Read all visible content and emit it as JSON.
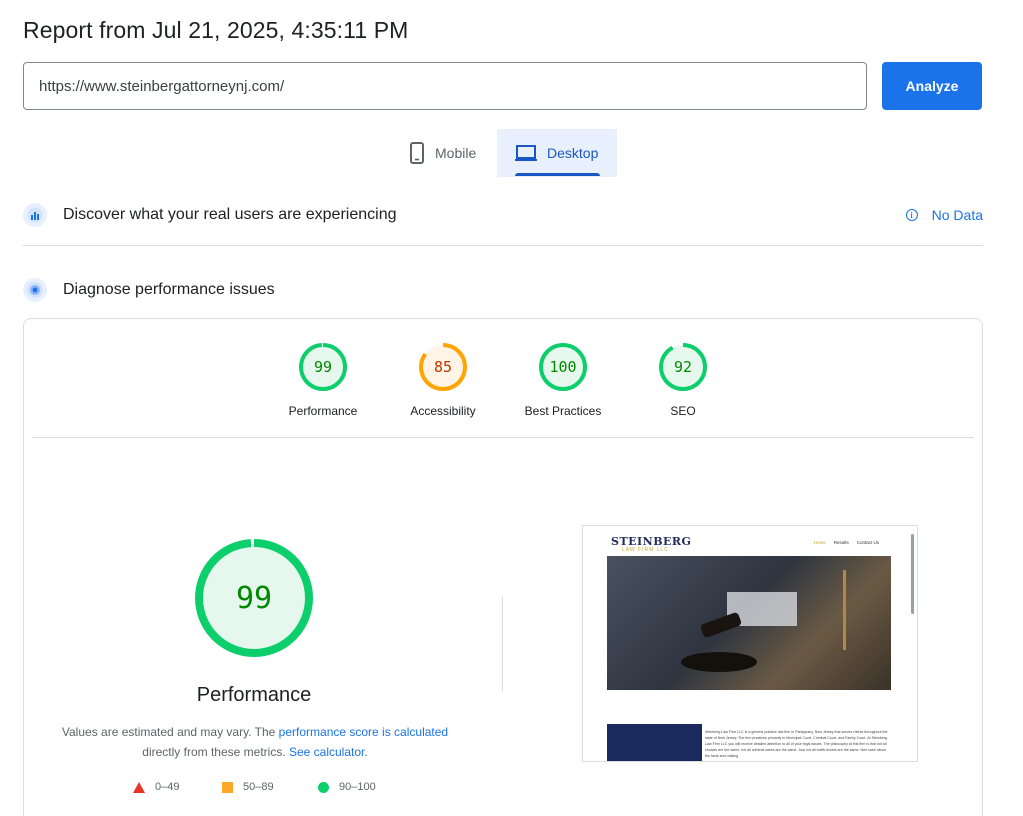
{
  "report": {
    "title": "Report from Jul 21, 2025, 4:35:11 PM"
  },
  "url_bar": {
    "value": "https://www.steinbergattorneynj.com/",
    "analyze_label": "Analyze"
  },
  "tabs": [
    {
      "label": "Mobile",
      "icon": "phone-icon",
      "selected": false
    },
    {
      "label": "Desktop",
      "icon": "laptop-icon",
      "selected": true
    }
  ],
  "field_data": {
    "title": "Discover what your real users are experiencing",
    "status": "No Data",
    "icon": "users-chart-icon"
  },
  "lab_data": {
    "title": "Diagnose performance issues",
    "icon": "radar-icon"
  },
  "scores": [
    {
      "label": "Performance",
      "value": "99",
      "fraction": 0.99,
      "color": "#0cce6b",
      "text_color": "#008800",
      "bg": "#e6f8ee"
    },
    {
      "label": "Accessibility",
      "value": "85",
      "fraction": 0.85,
      "color": "#ffa400",
      "text_color": "#c33300",
      "bg": "#fff4e5"
    },
    {
      "label": "Best Practices",
      "value": "100",
      "fraction": 1.0,
      "color": "#0cce6b",
      "text_color": "#008800",
      "bg": "#e6f8ee"
    },
    {
      "label": "SEO",
      "value": "92",
      "fraction": 0.92,
      "color": "#0cce6b",
      "text_color": "#008800",
      "bg": "#e6f8ee"
    }
  ],
  "performance": {
    "score": "99",
    "fraction": 0.99,
    "label": "Performance",
    "note_prefix": "Values are estimated and may vary. The ",
    "note_link1": "performance score is calculated",
    "note_middle": " directly from these metrics. ",
    "note_link2": "See calculator",
    "note_suffix": "."
  },
  "legend": [
    {
      "range": "0–49",
      "shape": "triangle",
      "color": "#eb3323"
    },
    {
      "range": "50–89",
      "shape": "square",
      "color": "#ffa726"
    },
    {
      "range": "90–100",
      "shape": "circle",
      "color": "#0cce6b"
    }
  ],
  "thumbnail": {
    "logo": "STEINBERG",
    "logo_sub": "LAW FIRM LLC",
    "nav": [
      "Home",
      "Results",
      "Contact Us"
    ],
    "body_text": "Steinberg Law Firm LLC is a general practice law firm in Parsippany, New Jersey that serves clients throughout the state of New Jersey. The firm practices primarily in Municipal Court, Criminal Court, and Family Court. At Steinberg Law Firm LLC you will receive detailed attention to all of your legal issues. The philosophy at this firm is that not all choices are the same, not all criminal cases are the same. Just not all traffic tickets are the same. Nee case about the facts and making"
  }
}
